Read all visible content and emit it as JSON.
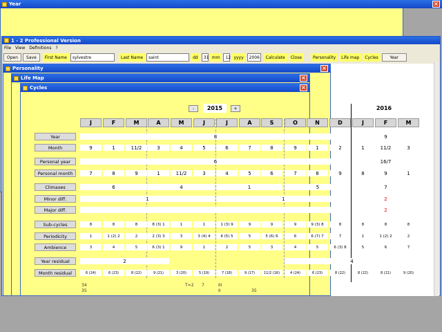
{
  "app": {
    "title": "1 - 2 Professional Version"
  },
  "menu": [
    "File",
    "View",
    "Definitions",
    "?"
  ],
  "toolbar": {
    "open": "Open",
    "save": "Save",
    "first_name_label": "First Name",
    "first_name_value": "sylvestre",
    "last_name_label": "Last Name",
    "last_name_value": "saint",
    "dd_label": "dd",
    "dd_value": "31",
    "mm_label": "mm",
    "mm_value": "12",
    "yyyy_label": "yyyy",
    "yyyy_value": "2006",
    "calculate": "Calculate",
    "close": "Close",
    "personality": "Personality",
    "life_map": "Life map",
    "cycles": "Cycles",
    "year": "Year"
  },
  "windows": {
    "personality": "Personality",
    "life_map": "Life Map",
    "cycles": "Cycles",
    "year": "Year"
  },
  "year_window": {
    "prev": "-",
    "next": "+",
    "year1": "2015",
    "year2": "2016",
    "months": [
      "J",
      "F",
      "M",
      "A",
      "M",
      "J",
      "J",
      "A",
      "S",
      "O",
      "N",
      "D",
      "J",
      "F",
      "M"
    ],
    "labels": {
      "year": "Year",
      "month": "Month",
      "personal_year": "Personal year",
      "personal_month": "Personal month",
      "climaxes": "Climaxes",
      "minor_diff": "Minor diff.",
      "major_diff": "Major diff.",
      "sub_cycles": "Sub-cycles",
      "periodicity": "Periodicity",
      "ambience": "Ambience",
      "year_residual": "Year residual",
      "month_residual": "Month residual"
    },
    "year_vals": {
      "a": "8",
      "b": "9"
    },
    "month_vals": [
      "9",
      "1",
      "11/2",
      "3",
      "4",
      "5",
      "6",
      "7",
      "8",
      "9",
      "1",
      "2",
      "1",
      "11/2",
      "3"
    ],
    "personal_year_vals": {
      "a": "6",
      "b": "16/7"
    },
    "personal_month_vals": [
      "7",
      "8",
      "9",
      "1",
      "11/2",
      "3",
      "4",
      "5",
      "6",
      "7",
      "8",
      "9",
      "8",
      "9",
      "1"
    ],
    "climax_vals": [
      "6",
      "4",
      "1",
      "5",
      "7"
    ],
    "minor_vals": [
      "1",
      "1",
      "2"
    ],
    "major_vals": [
      "2"
    ],
    "subcycle_vals": [
      "8",
      "8",
      "8",
      "8 (3) 1",
      "1",
      "1",
      "1 (3) 9",
      "9",
      "9",
      "9",
      "9 (3) 8",
      "8",
      "8",
      "8",
      "8"
    ],
    "periodicity_vals": [
      "1",
      "1 (2) 2",
      "2",
      "2 (3) 3",
      "3",
      "3 (4) 4",
      "4 (5) 5",
      "5",
      "5 (6) 6",
      "6",
      "6 (7) 7",
      "7",
      "1",
      "1 (2) 2",
      "2"
    ],
    "ambience_vals": [
      "3",
      "4",
      "5",
      "6 (3) 1",
      "9",
      "1",
      "2",
      "5",
      "3",
      "4",
      "5",
      "6 (3) 8",
      "5",
      "6",
      "7"
    ],
    "year_residual_vals": [
      "2",
      "4"
    ],
    "month_residual_vals": [
      "6 (24)",
      "6 (23)",
      "8 (22)",
      "9 (21)",
      "3 (20)",
      "5 (19)",
      "7 (18)",
      "9 (17)",
      "11/2 (16)",
      "4 (24)",
      "6 (23)",
      "8 (22)",
      "8 (22)",
      "8 (21)",
      "9 (20)"
    ]
  },
  "behind": {
    "line1": "34",
    "line2": "35",
    "t": "T=2",
    "seven": "7",
    "iii": "III",
    "ii": "II",
    "thirtyfive": "35"
  },
  "colors": {
    "title_blue": "#1448c8",
    "panel_yellow": "#ffff88",
    "highlight_red": "#e00000"
  }
}
